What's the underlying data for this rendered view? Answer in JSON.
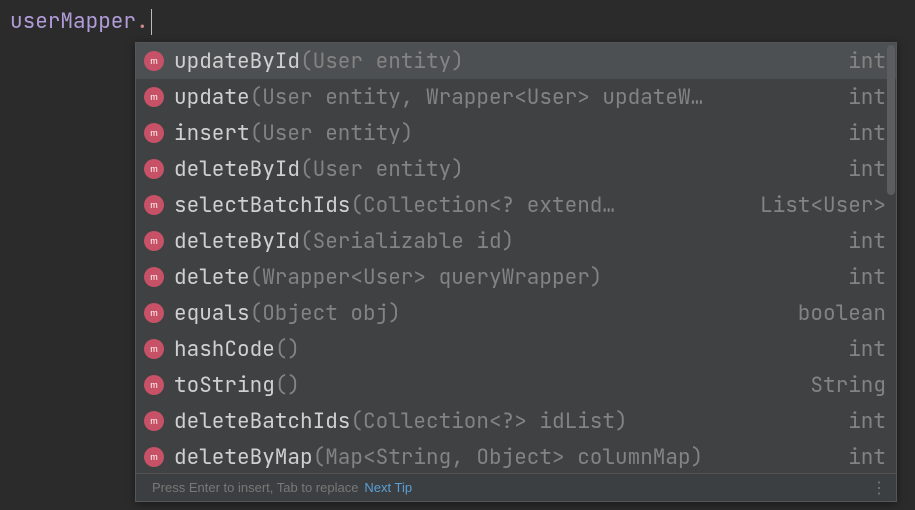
{
  "editor": {
    "variable": "userMapper",
    "dot": "."
  },
  "popup": {
    "items": [
      {
        "name": "updateById",
        "params": "(User entity)",
        "ret": "int",
        "selected": true
      },
      {
        "name": "update",
        "params": "(User entity, Wrapper<User> updateW…",
        "ret": "int",
        "selected": false
      },
      {
        "name": "insert",
        "params": "(User entity)",
        "ret": "int",
        "selected": false
      },
      {
        "name": "deleteById",
        "params": "(User entity)",
        "ret": "int",
        "selected": false
      },
      {
        "name": "selectBatchIds",
        "params": "(Collection<? extend…",
        "ret": "List<User>",
        "selected": false
      },
      {
        "name": "deleteById",
        "params": "(Serializable id)",
        "ret": "int",
        "selected": false
      },
      {
        "name": "delete",
        "params": "(Wrapper<User> queryWrapper)",
        "ret": "int",
        "selected": false
      },
      {
        "name": "equals",
        "params": "(Object obj)",
        "ret": "boolean",
        "selected": false
      },
      {
        "name": "hashCode",
        "params": "()",
        "ret": "int",
        "selected": false
      },
      {
        "name": "toString",
        "params": "()",
        "ret": "String",
        "selected": false
      },
      {
        "name": "deleteBatchIds",
        "params": "(Collection<?> idList)",
        "ret": "int",
        "selected": false
      },
      {
        "name": "deleteByMap",
        "params": "(Map<String, Object> columnMap)",
        "ret": "int",
        "selected": false
      }
    ],
    "footer": {
      "hint": "Press Enter to insert, Tab to replace",
      "link": "Next Tip",
      "more": "⋮"
    }
  }
}
